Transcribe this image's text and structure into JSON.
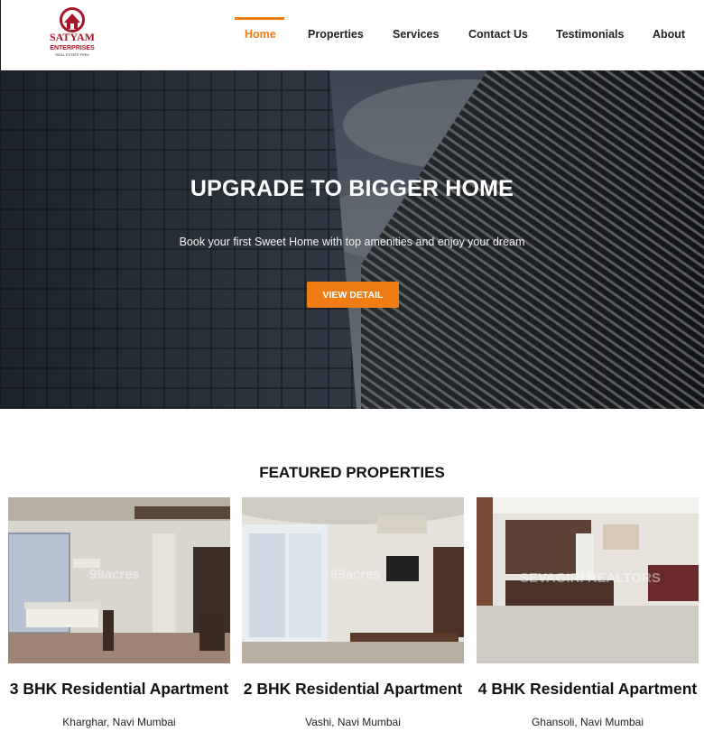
{
  "brand": {
    "name": "SATYAM",
    "subname": "ENTERPRISES",
    "tagline": "REAL ESTATE FIRM"
  },
  "nav": {
    "items": [
      "Home",
      "Properties",
      "Services",
      "Contact Us",
      "Testimonials",
      "About"
    ],
    "active": "Home"
  },
  "hero": {
    "title": "UPGRADE TO BIGGER HOME",
    "subtitle": "Book your first Sweet Home with top amenities and enjoy your dream",
    "button_label": "VIEW DETAIL"
  },
  "featured": {
    "title": "FEATURED PROPERTIES",
    "cards": [
      {
        "title": "3 BHK Residential Apartment",
        "location": "Kharghar, Navi Mumbai",
        "watermark": "99acres"
      },
      {
        "title": "2 BHK Residential Apartment",
        "location": "Vashi, Navi Mumbai",
        "watermark": "99acres"
      },
      {
        "title": "4 BHK Residential Apartment",
        "location": "Ghansoli, Navi Mumbai",
        "watermark": "SEVAGIRI REALTORS"
      }
    ]
  },
  "colors": {
    "accent": "#f07c14",
    "brand_red": "#a8162a"
  }
}
